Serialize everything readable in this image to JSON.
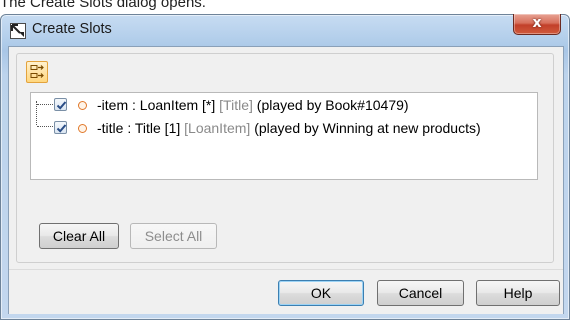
{
  "page": {
    "caption": "The Create Slots dialog opens."
  },
  "window": {
    "title": "Create Slots",
    "close_glyph": "x"
  },
  "toolbar": {
    "toggle_icon": "expand-tree-icon"
  },
  "tree": {
    "rows": [
      {
        "checked": true,
        "name": "-item : LoanItem [*]",
        "tag": "[Title]",
        "note": "(played by Book#10479)"
      },
      {
        "checked": true,
        "name": "-title : Title [1]",
        "tag": "[LoanItem]",
        "note": "(played by Winning at new products)"
      }
    ]
  },
  "buttons": {
    "clear_all": "Clear All",
    "select_all": "Select All",
    "ok": "OK",
    "cancel": "Cancel",
    "help": "Help"
  },
  "colors": {
    "slot_icon": "#e0782a",
    "toolbar_accent": "#ffd77f",
    "close_button": "#c2402a"
  }
}
